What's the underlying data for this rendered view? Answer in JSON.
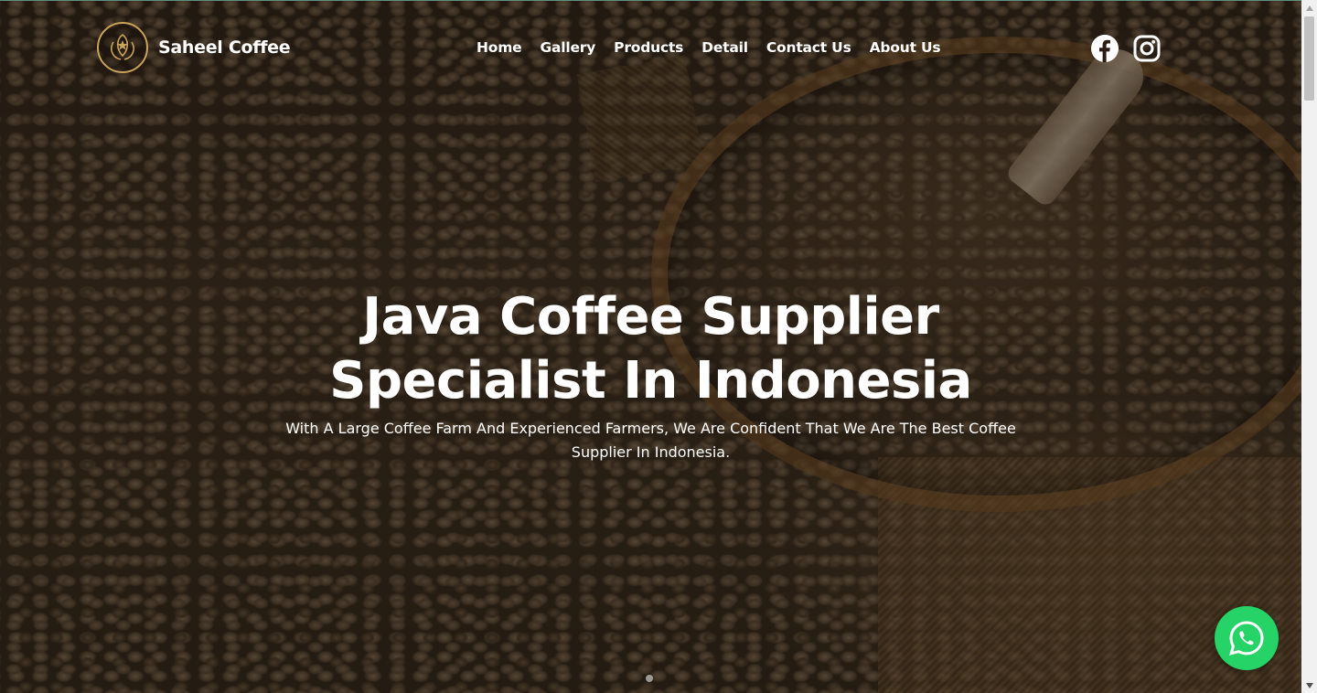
{
  "brand": {
    "name": "Saheel Coffee",
    "logo_icon": "coffee-bean-star-logo",
    "accent": "#c9a35a"
  },
  "nav": {
    "items": [
      {
        "label": "Home"
      },
      {
        "label": "Gallery"
      },
      {
        "label": "Products"
      },
      {
        "label": "Detail"
      },
      {
        "label": "Contact Us"
      },
      {
        "label": "About Us"
      }
    ]
  },
  "social": {
    "icons": [
      "facebook-icon",
      "instagram-icon"
    ]
  },
  "hero": {
    "title_line1": "Java Coffee Supplier",
    "title_line2": "Specialist In Indonesia",
    "subtitle": "With A Large Coffee Farm And Experienced Farmers, We Are Confident That We Are The Best Coffee Supplier In Indonesia."
  },
  "whatsapp": {
    "icon": "whatsapp-icon",
    "color": "#25d366"
  }
}
